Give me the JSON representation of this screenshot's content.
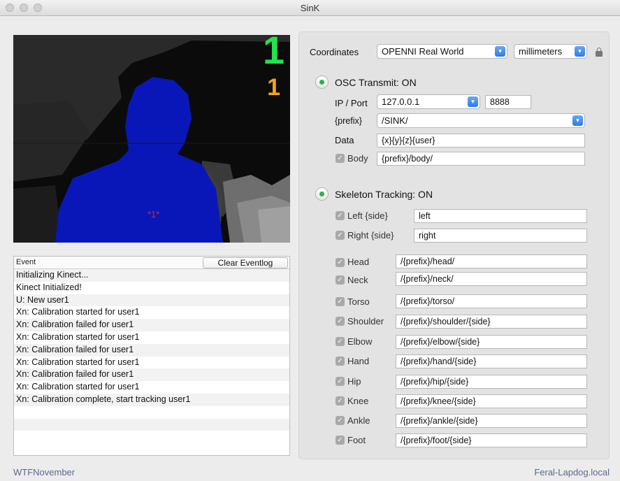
{
  "window": {
    "title": "SinK"
  },
  "depth_view": {
    "user_count": "1",
    "tracked_count": "1",
    "user_marker": "*1*"
  },
  "eventlog": {
    "header": "Event",
    "clear_label": "Clear Eventlog",
    "rows": [
      "Initializing Kinect...",
      "Kinect Initialized!",
      "U: New user1",
      "Xn: Calibration started for user1",
      "Xn: Calibration failed for user1",
      "Xn: Calibration started for user1",
      "Xn: Calibration failed for user1",
      "Xn: Calibration started for user1",
      "Xn: Calibration failed for user1",
      "Xn: Calibration started for user1",
      "Xn: Calibration complete, start tracking user1",
      "",
      "",
      ""
    ]
  },
  "coordinates": {
    "label": "Coordinates",
    "system": "OPENNI Real World",
    "units": "millimeters"
  },
  "osc": {
    "status": "OSC Transmit: ON",
    "ip_port_label": "IP / Port",
    "ip": "127.0.0.1",
    "port": "8888",
    "prefix_label": "{prefix}",
    "prefix": "/SINK/",
    "data_label": "Data",
    "data": "{x}{y}{z}{user}",
    "body_label": "Body",
    "body": "{prefix}/body/"
  },
  "skeleton": {
    "status": "Skeleton Tracking: ON",
    "left_label": "Left {side}",
    "left": "left",
    "right_label": "Right {side}",
    "right": "right",
    "joints": [
      {
        "label": "Head",
        "path": "/{prefix}/head/"
      },
      {
        "label": "Neck",
        "path": "/{prefix}/neck/"
      },
      {
        "label": "Torso",
        "path": "/{prefix}/torso/"
      },
      {
        "label": "Shoulder",
        "path": "/{prefix}/shoulder/{side}"
      },
      {
        "label": "Elbow",
        "path": "/{prefix}/elbow/{side}"
      },
      {
        "label": "Hand",
        "path": "/{prefix}/hand/{side}"
      },
      {
        "label": "Hip",
        "path": "/{prefix}/hip/{side}"
      },
      {
        "label": "Knee",
        "path": "/{prefix}/knee/{side}"
      },
      {
        "label": "Ankle",
        "path": "/{prefix}/ankle/{side}"
      },
      {
        "label": "Foot",
        "path": "/{prefix}/foot/{side}"
      }
    ]
  },
  "footer": {
    "left": "WTFNovember",
    "right": "Feral-Lapdog.local"
  },
  "colors": {
    "user_fill": "#0a17b8",
    "user_count": "#22e34c",
    "tracked_count": "#f2a321",
    "led_on": "#29b34a"
  }
}
